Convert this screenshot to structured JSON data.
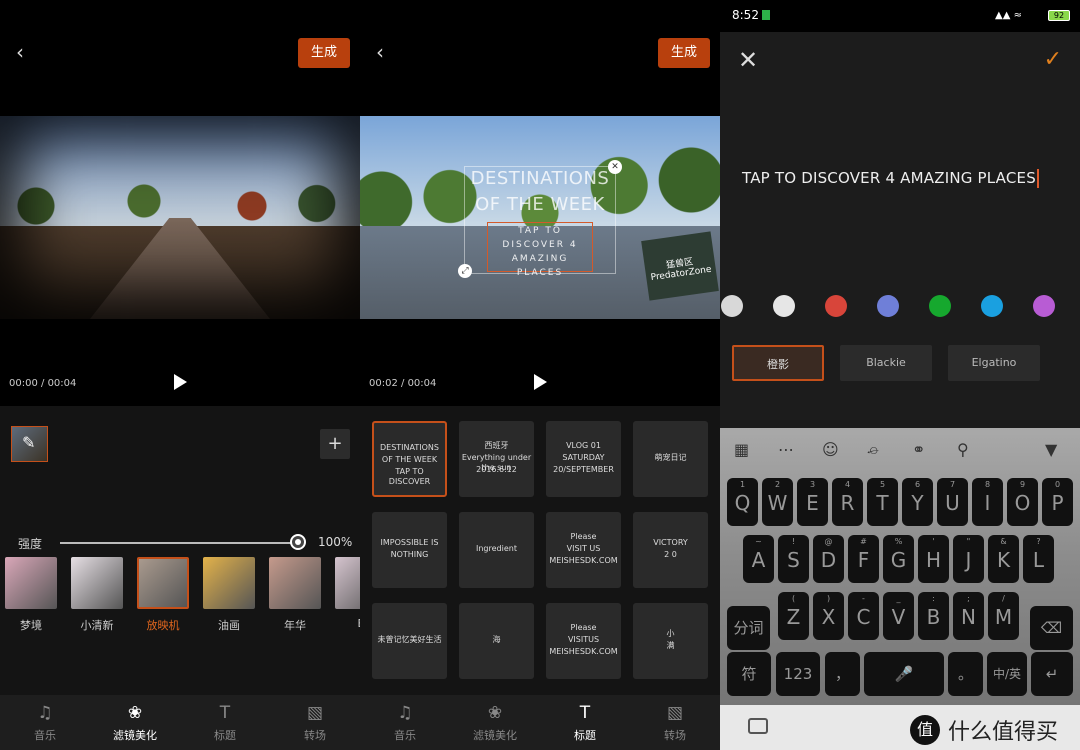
{
  "panel1": {
    "generate_label": "生成",
    "time_current": "00:00",
    "time_total": "00:04",
    "strength_label": "强度",
    "strength_value": "100%",
    "strength": 1.0,
    "filters": [
      {
        "label": "梦境",
        "color": "#d9a7b8"
      },
      {
        "label": "小清新",
        "color": "#e6dfe4"
      },
      {
        "label": "放映机",
        "color": "#a99a8e",
        "selected": true
      },
      {
        "label": "油画",
        "color": "#e3b24a"
      },
      {
        "label": "年华",
        "color": "#c59a8c"
      },
      {
        "label": "E",
        "color": "#d5c4ce"
      }
    ],
    "nav": [
      {
        "label": "音乐",
        "icon": "music-icon"
      },
      {
        "label": "滤镜美化",
        "icon": "filter-icon",
        "active": true
      },
      {
        "label": "标题",
        "icon": "title-icon"
      },
      {
        "label": "转场",
        "icon": "transition-icon"
      }
    ]
  },
  "panel2": {
    "generate_label": "生成",
    "time_current": "00:02",
    "time_total": "00:04",
    "overlay_title": "DESTINATIONS OF THE WEEK",
    "overlay_sub": "TAP TO DISCOVER 4 AMAZING PLACES",
    "sign_text": "猛兽区 PredatorZone",
    "titles": [
      {
        "lines": [
          "DESTINATIONS",
          "OF THE WEEK",
          "TAP TO DISCOVER"
        ],
        "selected": true
      },
      {
        "lines": [
          "西班牙",
          "Everything under the sun",
          "2016.6.12"
        ]
      },
      {
        "lines": [
          "VLOG 01",
          "SATURDAY",
          "20/SEPTEMBER"
        ]
      },
      {
        "lines": [
          "萌宠日记"
        ]
      },
      {
        "lines": [
          "IMPOSSIBLE IS",
          "NOTHING"
        ]
      },
      {
        "lines": [
          "Ingredient"
        ]
      },
      {
        "lines": [
          "Please",
          "VISIT US",
          "MEISHESDK.COM"
        ]
      },
      {
        "lines": [
          "VICTORY",
          "2 0"
        ]
      },
      {
        "lines": [
          "未曾记忆美好生活"
        ]
      },
      {
        "lines": [
          "海"
        ]
      },
      {
        "lines": [
          "Please",
          "VISITUS",
          "MEISHESDK.COM"
        ]
      },
      {
        "lines": [
          "小",
          "满"
        ]
      }
    ],
    "nav": [
      {
        "label": "音乐",
        "icon": "music-icon"
      },
      {
        "label": "滤镜美化",
        "icon": "filter-icon"
      },
      {
        "label": "标题",
        "icon": "title-icon",
        "active": true
      },
      {
        "label": "转场",
        "icon": "transition-icon"
      }
    ]
  },
  "panel3": {
    "clock": "8:52",
    "battery": "92",
    "edit_text": "TAP TO DISCOVER 4 AMAZING PLACES",
    "swatches": [
      "#d8d8d8",
      "#e6e6e6",
      "#d8453a",
      "#6f7fd8",
      "#16a82e",
      "#1aa0e0",
      "#b85cd4"
    ],
    "fonts": [
      {
        "label": "橙影",
        "selected": true
      },
      {
        "label": "Blackie"
      },
      {
        "label": "Elgatino"
      }
    ],
    "keys_row1": [
      {
        "m": "Q",
        "s": "1"
      },
      {
        "m": "W",
        "s": "2"
      },
      {
        "m": "E",
        "s": "3"
      },
      {
        "m": "R",
        "s": "4"
      },
      {
        "m": "T",
        "s": "5"
      },
      {
        "m": "Y",
        "s": "6"
      },
      {
        "m": "U",
        "s": "7"
      },
      {
        "m": "I",
        "s": "8"
      },
      {
        "m": "O",
        "s": "9"
      },
      {
        "m": "P",
        "s": "0"
      }
    ],
    "keys_row2": [
      {
        "m": "A",
        "s": "~"
      },
      {
        "m": "S",
        "s": "!"
      },
      {
        "m": "D",
        "s": "@"
      },
      {
        "m": "F",
        "s": "#"
      },
      {
        "m": "G",
        "s": "%"
      },
      {
        "m": "H",
        "s": "'"
      },
      {
        "m": "J",
        "s": "\""
      },
      {
        "m": "K",
        "s": "&"
      },
      {
        "m": "L",
        "s": "?"
      }
    ],
    "keys_row3": [
      {
        "m": "Z",
        "s": "("
      },
      {
        "m": "X",
        "s": ")"
      },
      {
        "m": "C",
        "s": "-"
      },
      {
        "m": "V",
        "s": "_"
      },
      {
        "m": "B",
        "s": ":"
      },
      {
        "m": "N",
        "s": ";"
      },
      {
        "m": "M",
        "s": "/"
      }
    ],
    "key_fenci": "分词",
    "key_fu": "符",
    "key_123": "123",
    "key_comma": "，",
    "key_period": "。",
    "key_lang": "中/英",
    "brand": "什么值得买"
  }
}
